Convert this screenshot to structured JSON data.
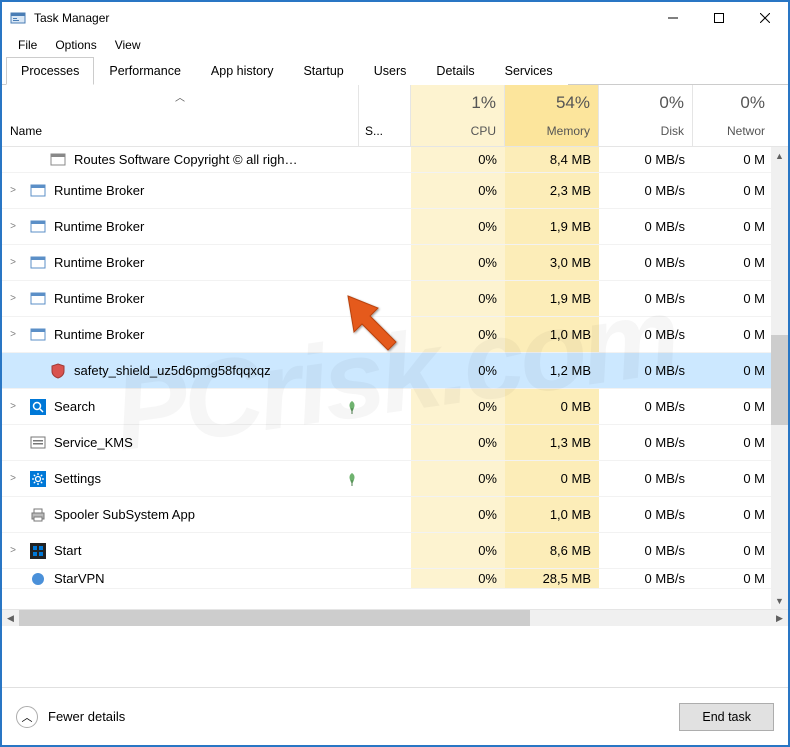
{
  "window": {
    "title": "Task Manager"
  },
  "menu": {
    "file": "File",
    "options": "Options",
    "view": "View"
  },
  "tabs": [
    "Processes",
    "Performance",
    "App history",
    "Startup",
    "Users",
    "Details",
    "Services"
  ],
  "activeTab": 0,
  "columns": {
    "name": "Name",
    "s": "S...",
    "cpu": {
      "pct": "1%",
      "label": "CPU"
    },
    "mem": {
      "pct": "54%",
      "label": "Memory"
    },
    "disk": {
      "pct": "0%",
      "label": "Disk"
    },
    "net": {
      "pct": "0%",
      "label": "Networ"
    }
  },
  "rows": [
    {
      "exp": "",
      "indent": true,
      "icon": "app",
      "name": "Routes Software Copyright © all righ…",
      "leaf": "",
      "cpu": "0%",
      "mem": "8,4 MB",
      "disk": "0 MB/s",
      "net": "0 M"
    },
    {
      "exp": ">",
      "icon": "win",
      "name": "Runtime Broker",
      "leaf": "",
      "cpu": "0%",
      "mem": "2,3 MB",
      "disk": "0 MB/s",
      "net": "0 M"
    },
    {
      "exp": ">",
      "icon": "win",
      "name": "Runtime Broker",
      "leaf": "",
      "cpu": "0%",
      "mem": "1,9 MB",
      "disk": "0 MB/s",
      "net": "0 M"
    },
    {
      "exp": ">",
      "icon": "win",
      "name": "Runtime Broker",
      "leaf": "",
      "cpu": "0%",
      "mem": "3,0 MB",
      "disk": "0 MB/s",
      "net": "0 M"
    },
    {
      "exp": ">",
      "icon": "win",
      "name": "Runtime Broker",
      "leaf": "",
      "cpu": "0%",
      "mem": "1,9 MB",
      "disk": "0 MB/s",
      "net": "0 M"
    },
    {
      "exp": ">",
      "icon": "win",
      "name": "Runtime Broker",
      "leaf": "",
      "cpu": "0%",
      "mem": "1,0 MB",
      "disk": "0 MB/s",
      "net": "0 M"
    },
    {
      "exp": "",
      "indent": true,
      "icon": "shield",
      "name": "safety_shield_uz5d6pmg58fqqxqz",
      "leaf": "",
      "cpu": "0%",
      "mem": "1,2 MB",
      "disk": "0 MB/s",
      "net": "0 M",
      "selected": true
    },
    {
      "exp": ">",
      "icon": "search",
      "name": "Search",
      "leaf": "leaf",
      "cpu": "0%",
      "mem": "0 MB",
      "disk": "0 MB/s",
      "net": "0 M"
    },
    {
      "exp": "",
      "icon": "svc",
      "name": "Service_KMS",
      "leaf": "",
      "cpu": "0%",
      "mem": "1,3 MB",
      "disk": "0 MB/s",
      "net": "0 M"
    },
    {
      "exp": ">",
      "icon": "settings",
      "name": "Settings",
      "leaf": "leaf",
      "cpu": "0%",
      "mem": "0 MB",
      "disk": "0 MB/s",
      "net": "0 M"
    },
    {
      "exp": "",
      "icon": "printer",
      "name": "Spooler SubSystem App",
      "leaf": "",
      "cpu": "0%",
      "mem": "1,0 MB",
      "disk": "0 MB/s",
      "net": "0 M"
    },
    {
      "exp": ">",
      "icon": "start",
      "name": "Start",
      "leaf": "",
      "cpu": "0%",
      "mem": "8,6 MB",
      "disk": "0 MB/s",
      "net": "0 M"
    },
    {
      "exp": "",
      "icon": "vpn",
      "name": "StarVPN",
      "leaf": "",
      "cpu": "0%",
      "mem": "28,5 MB",
      "disk": "0 MB/s",
      "net": "0 M"
    }
  ],
  "footer": {
    "fewer": "Fewer details",
    "endTask": "End task"
  },
  "watermark": "PCrisk.com"
}
